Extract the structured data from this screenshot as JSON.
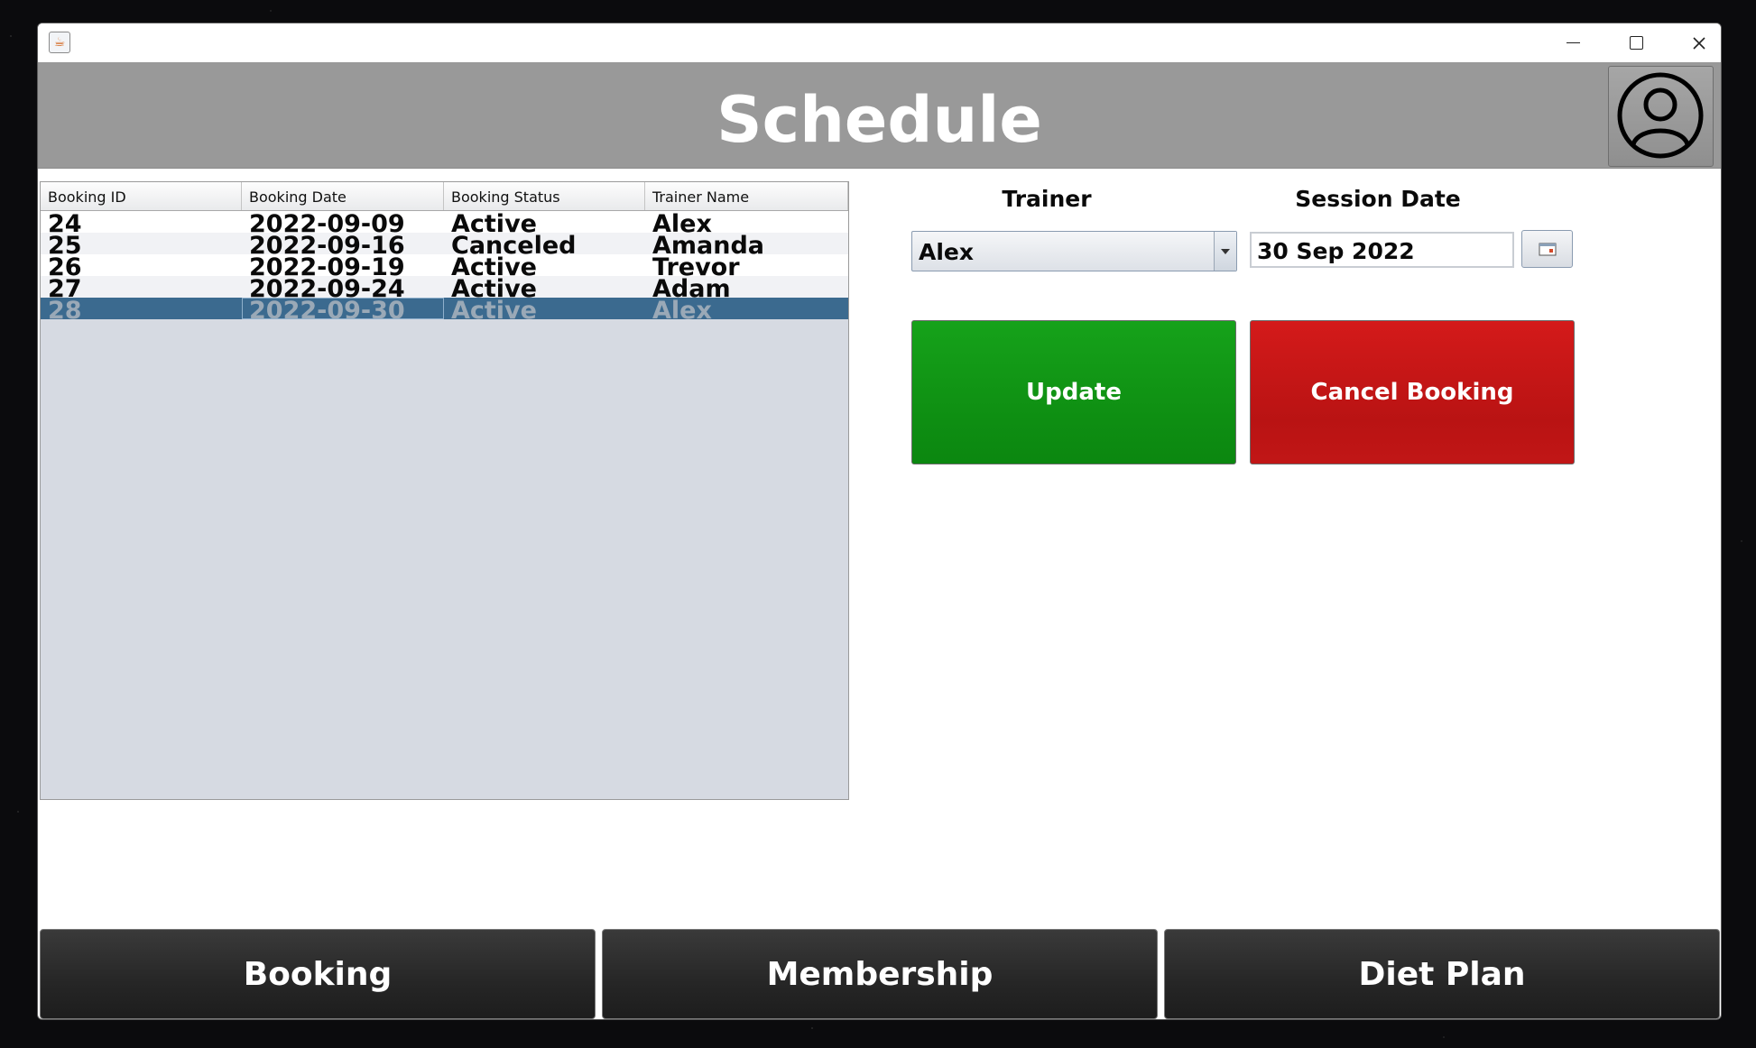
{
  "window": {
    "app_icon": "java-cup-icon",
    "controls": [
      "minimize-icon",
      "maximize-icon",
      "close-icon"
    ]
  },
  "header": {
    "title": "Schedule",
    "profile_icon": "user-profile-icon"
  },
  "table": {
    "columns": [
      "Booking ID",
      "Booking Date",
      "Booking Status",
      "Trainer Name"
    ],
    "rows": [
      [
        "24",
        "2022-09-09",
        "Active",
        "Alex"
      ],
      [
        "25",
        "2022-09-16",
        "Canceled",
        "Amanda"
      ],
      [
        "26",
        "2022-09-19",
        "Active",
        "Trevor"
      ],
      [
        "27",
        "2022-09-24",
        "Active",
        "Adam"
      ],
      [
        "28",
        "2022-09-30",
        "Active",
        "Alex"
      ]
    ],
    "selected_row": 4
  },
  "form": {
    "trainer_label": "Trainer",
    "trainer_value": "Alex",
    "session_date_label": "Session Date",
    "session_date_value": "30 Sep 2022",
    "calendar_icon": "calendar-icon"
  },
  "actions": {
    "update_label": "Update",
    "cancel_label": "Cancel Booking"
  },
  "nav": {
    "booking_label": "Booking",
    "membership_label": "Membership",
    "diet_plan_label": "Diet Plan"
  },
  "colors": {
    "header_bg": "#999999",
    "update_green": "#109814",
    "cancel_red": "#c71515",
    "selection_blue": "#3b6a8f",
    "nav_dark": "#262626"
  }
}
